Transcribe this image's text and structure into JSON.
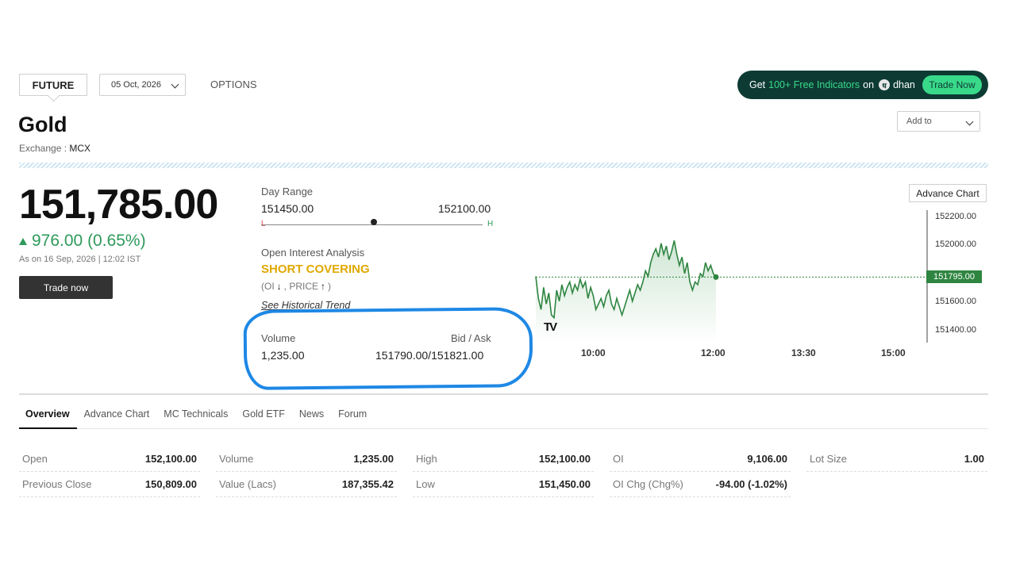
{
  "header": {
    "future_label": "FUTURE",
    "expiry_date": "05 Oct, 2026",
    "options_label": "OPTIONS",
    "promo": {
      "prefix": "Get",
      "highlight": "100+ Free Indicators",
      "mid": "on",
      "brand": "dhan",
      "cta": "Trade Now"
    },
    "title": "Gold",
    "exchange_label": "Exchange :",
    "exchange_value": "MCX",
    "add_to_placeholder": "Add to"
  },
  "quote": {
    "price": "151,785.00",
    "change": "976.00 (0.65%)",
    "as_of": "As on 16 Sep, 2026 | 12:02 IST",
    "trade_button": "Trade now"
  },
  "details": {
    "day_range_label": "Day Range",
    "day_low": "151450.00",
    "day_high": "152100.00",
    "day_current_fraction": 0.51,
    "low_marker": "L",
    "high_marker": "H",
    "oi_analysis_label": "Open Interest Analysis",
    "oi_status": "SHORT COVERING",
    "oi_prefix": "(OI",
    "oi_mid": ", PRICE",
    "oi_suffix": ")",
    "historical_link": "See Historical Trend",
    "volume_label": "Volume",
    "volume_value": "1,235.00",
    "bid_ask_label": "Bid / Ask",
    "bid_ask_value": "151790.00/151821.00"
  },
  "chart": {
    "advance_chart_button": "Advance Chart",
    "tv_logo": "TV",
    "current_price_tag": "151795.00",
    "y_ticks": [
      "152200.00",
      "152000.00",
      "151600.00",
      "151400.00"
    ],
    "x_ticks": [
      "10:00",
      "12:00",
      "13:30",
      "15:00"
    ],
    "colors": {
      "line": "#2e8540",
      "fill_top": "#cfe6d4",
      "tag": "#2e8540"
    }
  },
  "chart_data": {
    "type": "area",
    "x_label_ticks": [
      "10:00",
      "12:00",
      "13:30",
      "15:00"
    ],
    "ylim": [
      151320,
      152280
    ],
    "y_ticks": [
      152200,
      152000,
      151600,
      151400
    ],
    "series": [
      {
        "values": [
          151800,
          151640,
          151560,
          151720,
          151600,
          151680,
          151520,
          151500,
          151700,
          151620,
          151740,
          151660,
          151720,
          151760,
          151680,
          151740,
          151700,
          151780,
          151720,
          151760,
          151640,
          151720,
          151660,
          151560,
          151600,
          151640,
          151580,
          151660,
          151700,
          151600,
          151560,
          151640,
          151580,
          151520,
          151580,
          151640,
          151700,
          151620,
          151680,
          151740,
          151700,
          151760,
          151840,
          151800,
          151900,
          151960,
          152000,
          151940,
          152040,
          151960,
          152020,
          151920,
          151980,
          152060,
          151960,
          151880,
          151940,
          151820,
          151900,
          151760,
          151700,
          151760,
          151740,
          151820,
          151800,
          151900,
          151840,
          151880,
          151820,
          151795
        ]
      }
    ],
    "reference_line": 151795
  },
  "tabs": [
    "Overview",
    "Advance Chart",
    "MC Technicals",
    "Gold ETF",
    "News",
    "Forum"
  ],
  "stats": [
    [
      {
        "k": "Open",
        "v": "152,100.00"
      },
      {
        "k": "Volume",
        "v": "1,235.00"
      },
      {
        "k": "High",
        "v": "152,100.00"
      },
      {
        "k": "OI",
        "v": "9,106.00"
      },
      {
        "k": "Lot Size",
        "v": "1.00"
      }
    ],
    [
      {
        "k": "Previous Close",
        "v": "150,809.00"
      },
      {
        "k": "Value (Lacs)",
        "v": "187,355.42"
      },
      {
        "k": "Low",
        "v": "151,450.00"
      },
      {
        "k": "OI Chg (Chg%)",
        "v": "-94.00 (-1.02%)"
      },
      null
    ]
  ]
}
